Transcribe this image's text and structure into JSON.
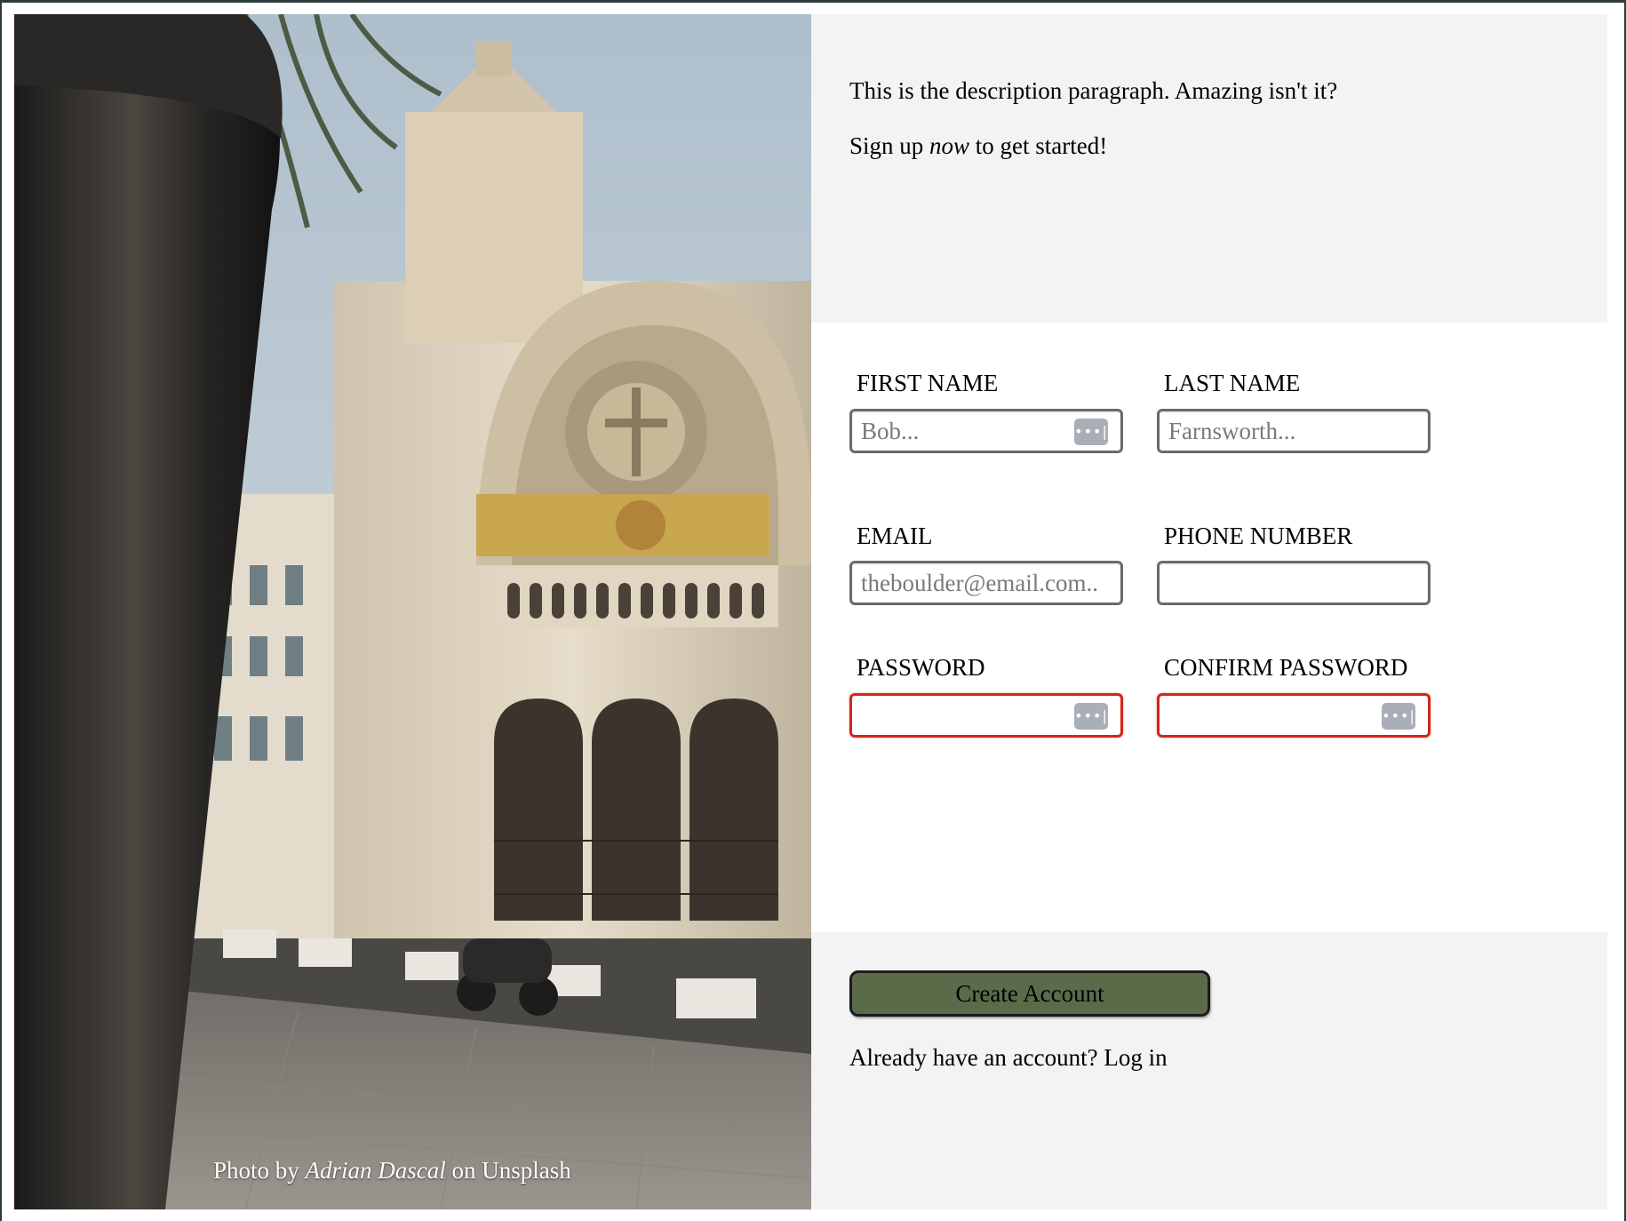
{
  "photo": {
    "credit_prefix": "Photo by ",
    "credit_author": "Adrian Dascal",
    "credit_suffix": " on Unsplash"
  },
  "intro": {
    "description": "This is the description paragraph. Amazing isn't it?",
    "signup_prefix": "Sign up ",
    "signup_emphasis": "now",
    "signup_suffix": " to get started!"
  },
  "form": {
    "first_name": {
      "label": "FIRST NAME",
      "placeholder": "Bob...",
      "value": ""
    },
    "last_name": {
      "label": "LAST NAME",
      "placeholder": "Farnsworth...",
      "value": ""
    },
    "email": {
      "label": "EMAIL",
      "placeholder": "theboulder@email.com..",
      "value": ""
    },
    "phone": {
      "label": "PHONE NUMBER",
      "placeholder": "",
      "value": ""
    },
    "password": {
      "label": "PASSWORD",
      "placeholder": "",
      "value": "",
      "status": "invalid"
    },
    "confirm_password": {
      "label": "CONFIRM PASSWORD",
      "placeholder": "",
      "value": "",
      "status": "invalid"
    }
  },
  "actions": {
    "create_account_label": "Create Account",
    "login_prefix": "Already have an account? ",
    "login_link": "Log in"
  },
  "icons": {
    "password_manager": "password-manager-key-icon"
  },
  "colors": {
    "panel_background": "#f3f3f3",
    "button_background": "#5b6b4a",
    "invalid_border": "#d1271b"
  }
}
